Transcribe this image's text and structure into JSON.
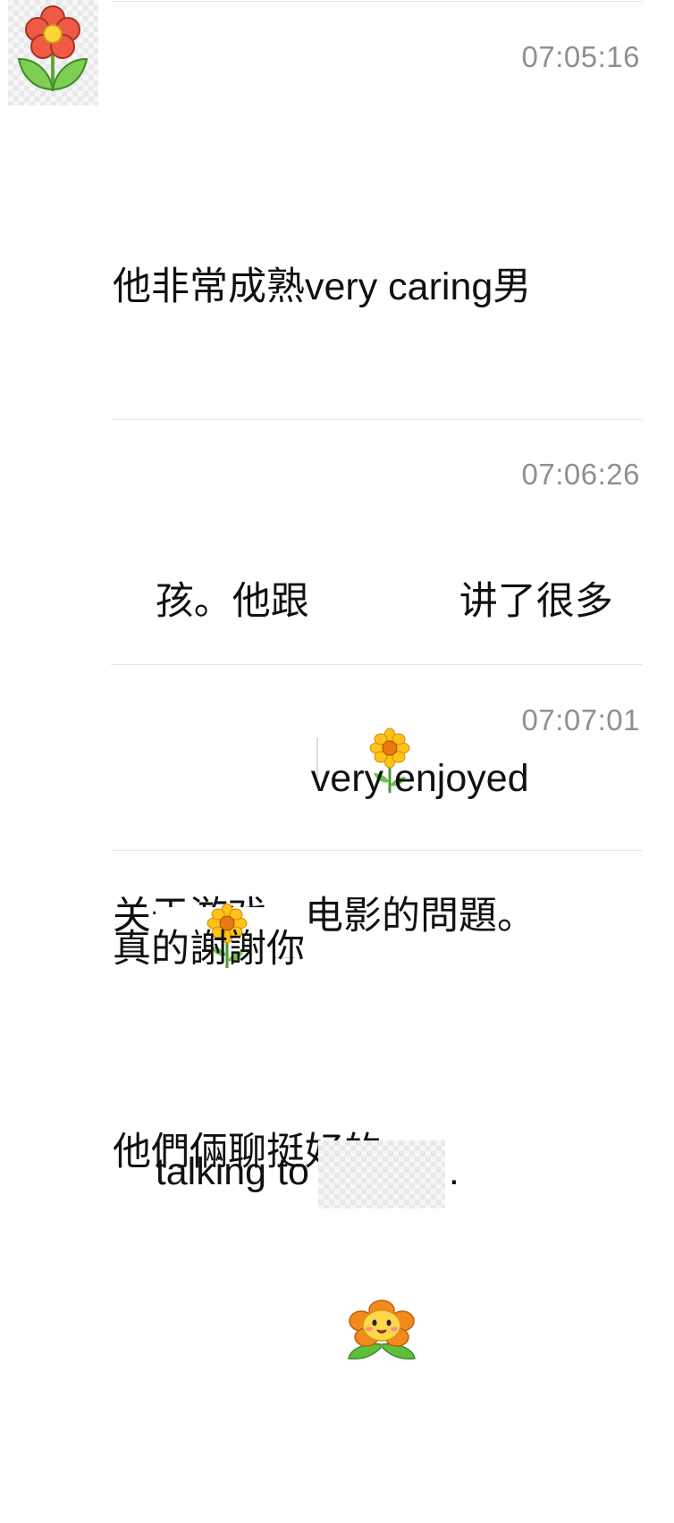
{
  "avatar": {
    "icon": "red-flower-icon",
    "colors": {
      "petal": "#e84b3a",
      "center": "#ffd23a",
      "leaf": "#6cc24a"
    }
  },
  "messages": [
    {
      "time": "07:05:16",
      "line1": "他非常成熟very caring男",
      "line2_before": "孩。他跟",
      "line2_after": "讲了很多",
      "line3": "关于游戏，电影的問題。",
      "line4": "他們倆聊挺好的。",
      "emoji": "sunflower-sticker-icon"
    },
    {
      "time": "07:06:26",
      "line1_after": "very enjoyed",
      "line2_before": "talking to",
      "line2_after": ".",
      "emoji_first": "sunflower-sticker-icon",
      "emoji_second": "smiling-orange-flower-sticker-icon"
    },
    {
      "time": "07:07:01",
      "line1": "真的謝謝你"
    }
  ],
  "colors": {
    "timestamp": "#8f8f8f",
    "divider": "#e6e6e6",
    "text": "#111111"
  }
}
